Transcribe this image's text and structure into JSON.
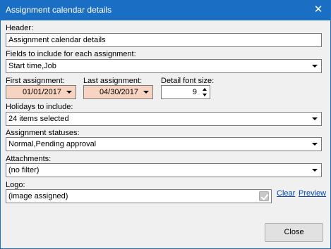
{
  "window": {
    "title": "Assignment calendar details",
    "close_glyph": "✕"
  },
  "header": {
    "label": "Header:",
    "value": "Assignment calendar details"
  },
  "fields": {
    "label": "Fields to include for each assignment:",
    "value": "Start time,Job"
  },
  "first_assignment": {
    "label": "First assignment:",
    "value": "01/01/2017"
  },
  "last_assignment": {
    "label": "Last assignment:",
    "value": "04/30/2017"
  },
  "detail_font_size": {
    "label": "Detail font size:",
    "value": "9"
  },
  "holidays": {
    "label": "Holidays to include:",
    "value": "24 items selected"
  },
  "statuses": {
    "label": "Assignment statuses:",
    "value": "Normal,Pending approval"
  },
  "attachments": {
    "label": "Attachments:",
    "value": "(no filter)"
  },
  "logo": {
    "label": "Logo:",
    "value": "(image assigned)",
    "clear_label": "Clear",
    "preview_label": "Preview"
  },
  "buttons": {
    "close_label": "Close"
  },
  "colors": {
    "titlebar": "#1a6fc4",
    "date_field": "#f7d4c2",
    "link": "#0645ad"
  },
  "icons": {
    "dropdown": "chevron-down-icon",
    "spin": "spin-arrows-icon",
    "logo": "checkmark-image-icon"
  }
}
